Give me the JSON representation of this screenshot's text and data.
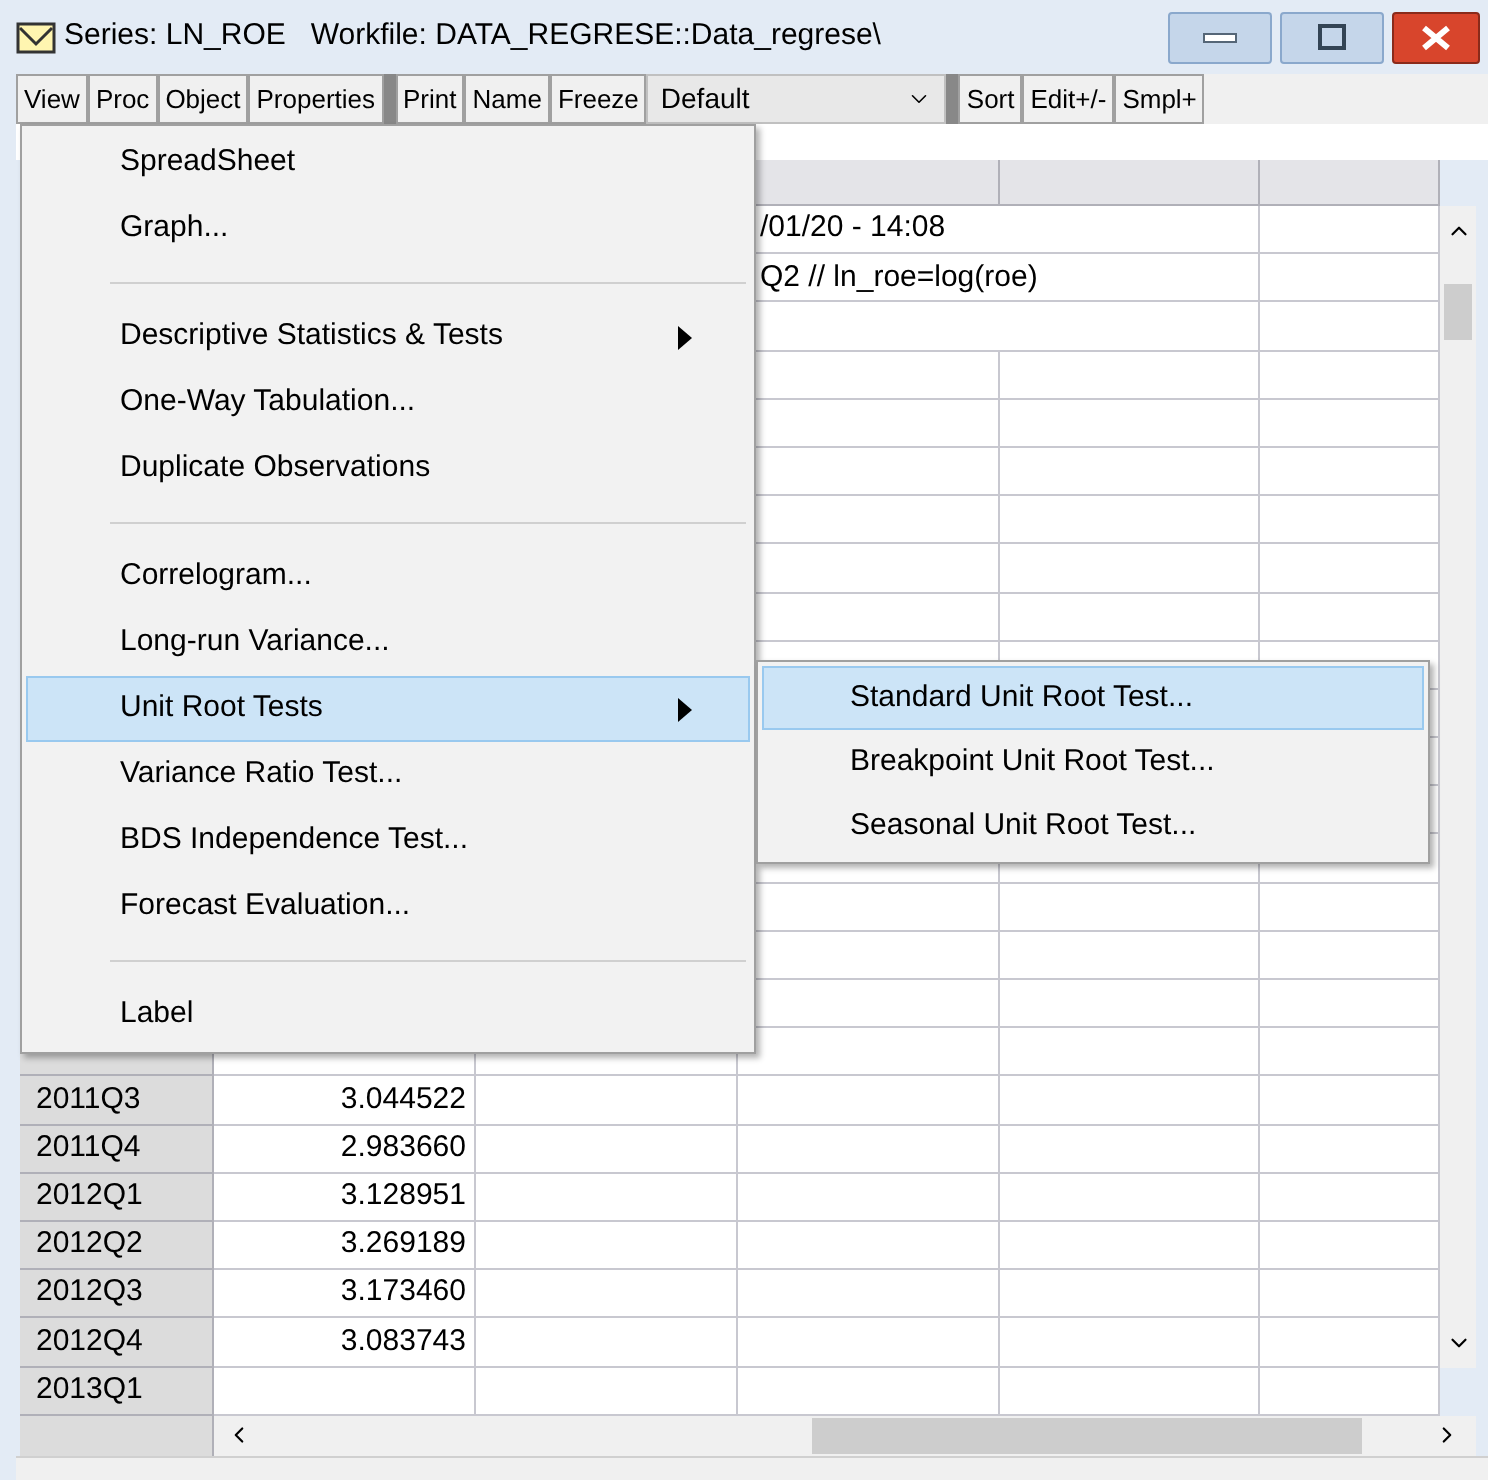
{
  "window": {
    "title": "Series: LN_ROE   Workfile: DATA_REGRESE::Data_regrese\\"
  },
  "toolbar": [
    {
      "kind": "button",
      "label": "View"
    },
    {
      "kind": "button",
      "label": "Proc"
    },
    {
      "kind": "button",
      "label": "Object"
    },
    {
      "kind": "button",
      "label": "Properties"
    },
    {
      "kind": "gap"
    },
    {
      "kind": "button",
      "label": "Print"
    },
    {
      "kind": "button",
      "label": "Name"
    },
    {
      "kind": "button",
      "label": "Freeze"
    },
    {
      "kind": "dropdown",
      "label": "Default"
    },
    {
      "kind": "gap"
    },
    {
      "kind": "button",
      "label": "Sort"
    },
    {
      "kind": "button",
      "label": "Edit+/-"
    },
    {
      "kind": "button",
      "label": "Smpl+"
    }
  ],
  "menu": {
    "items": [
      {
        "kind": "item",
        "label": "SpreadSheet",
        "submenu": false,
        "selected": false
      },
      {
        "kind": "item",
        "label": "Graph...",
        "submenu": false,
        "selected": false
      },
      {
        "kind": "separator"
      },
      {
        "kind": "item",
        "label": "Descriptive Statistics & Tests",
        "submenu": true,
        "selected": false
      },
      {
        "kind": "item",
        "label": "One-Way Tabulation...",
        "submenu": false,
        "selected": false
      },
      {
        "kind": "item",
        "label": "Duplicate Observations",
        "submenu": false,
        "selected": false
      },
      {
        "kind": "separator"
      },
      {
        "kind": "item",
        "label": "Correlogram...",
        "submenu": false,
        "selected": false
      },
      {
        "kind": "item",
        "label": "Long-run Variance...",
        "submenu": false,
        "selected": false
      },
      {
        "kind": "item",
        "label": "Unit Root Tests",
        "submenu": true,
        "selected": true
      },
      {
        "kind": "item",
        "label": "Variance Ratio Test...",
        "submenu": false,
        "selected": false
      },
      {
        "kind": "item",
        "label": "BDS Independence Test...",
        "submenu": false,
        "selected": false
      },
      {
        "kind": "item",
        "label": "Forecast Evaluation...",
        "submenu": false,
        "selected": false
      },
      {
        "kind": "separator"
      },
      {
        "kind": "item",
        "label": "Label",
        "submenu": false,
        "selected": false
      }
    ]
  },
  "submenu": {
    "items": [
      {
        "label": "Standard Unit Root Test...",
        "selected": true
      },
      {
        "label": "Breakpoint Unit Root Test...",
        "selected": false
      },
      {
        "label": "Seasonal Unit Root Test...",
        "selected": false
      }
    ]
  },
  "grid": {
    "comment_rows": [
      "/01/20 - 14:08",
      "Q2 // ln_roe=log(roe)"
    ],
    "rows": [
      {
        "label": "2011Q3",
        "value": "3.044522"
      },
      {
        "label": "2011Q4",
        "value": "2.983660"
      },
      {
        "label": "2012Q1",
        "value": "3.128951"
      },
      {
        "label": "2012Q2",
        "value": "3.269189"
      },
      {
        "label": "2012Q3",
        "value": "3.173460"
      },
      {
        "label": "2012Q4",
        "value": "3.083743"
      },
      {
        "label": "2013Q1"
      }
    ]
  }
}
